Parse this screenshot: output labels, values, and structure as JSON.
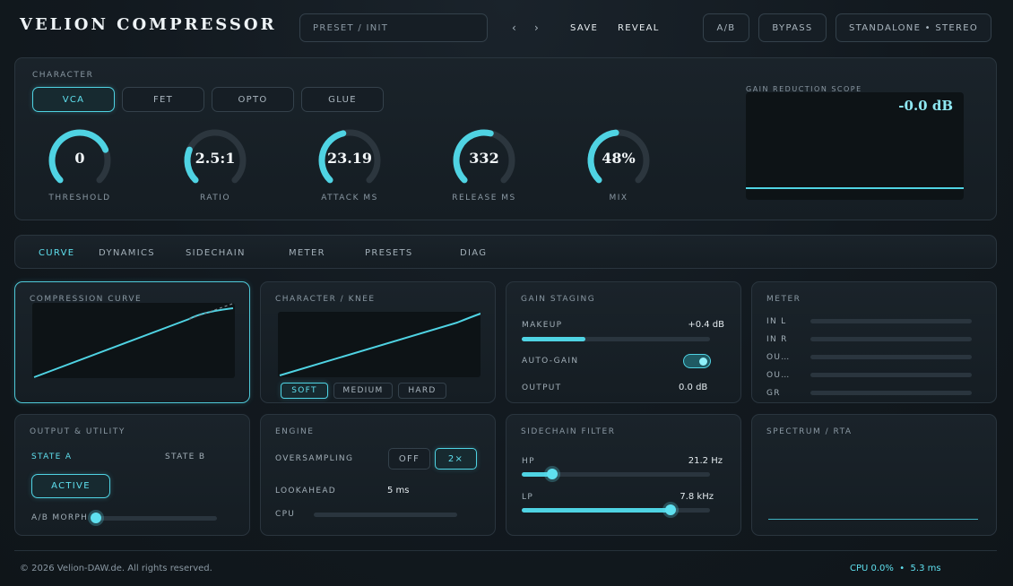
{
  "header": {
    "title": "VELION COMPRESSOR",
    "preset": "PRESET / INIT",
    "prev": "‹",
    "next": "›",
    "save": "SAVE",
    "reveal": "REVEAL",
    "ab": "A/B",
    "bypass": "BYPASS",
    "mode": "STANDALONE • STEREO"
  },
  "character": {
    "label": "CHARACTER",
    "modes": [
      "VCA",
      "FET",
      "OPTO",
      "GLUE"
    ],
    "active_mode": "VCA",
    "knobs": [
      {
        "label": "THRESHOLD",
        "value": "0",
        "level": 0.75
      },
      {
        "label": "RATIO",
        "value": "2.5:1",
        "level": 0.25
      },
      {
        "label": "ATTACK MS",
        "value": "23.19",
        "level": 0.45
      },
      {
        "label": "RELEASE MS",
        "value": "332",
        "level": 0.55
      },
      {
        "label": "MIX",
        "value": "48%",
        "level": 0.48
      }
    ]
  },
  "scope": {
    "label": "GAIN REDUCTION SCOPE",
    "value": "-0.0 dB"
  },
  "tabs": [
    "CURVE",
    "DYNAMICS",
    "SIDECHAIN",
    "METER",
    "PRESETS",
    "DIAG"
  ],
  "active_tab": "CURVE",
  "compression_curve": {
    "title": "COMPRESSION CURVE"
  },
  "knee": {
    "title": "CHARACTER / KNEE",
    "options": [
      "SOFT",
      "MEDIUM",
      "HARD"
    ],
    "active": "SOFT"
  },
  "gain_staging": {
    "title": "GAIN STAGING",
    "makeup_label": "MAKEUP",
    "makeup_value": "+0.4 dB",
    "makeup_level": 0.34,
    "autogain_label": "AUTO-GAIN",
    "autogain_on": true,
    "output_label": "OUTPUT",
    "output_value": "0.0 dB"
  },
  "meter": {
    "title": "METER",
    "channels": [
      "IN L",
      "IN R",
      "OU…",
      "OU…",
      "GR"
    ]
  },
  "output_utility": {
    "title": "OUTPUT & UTILITY",
    "state_a": "STATE A",
    "state_b": "STATE B",
    "active_btn": "ACTIVE",
    "morph_label": "A/B MORPH",
    "morph_level": 0.0
  },
  "engine": {
    "title": "ENGINE",
    "oversampling_label": "OVERSAMPLING",
    "os_options": [
      "OFF",
      "2×"
    ],
    "os_active": "2×",
    "lookahead_label": "LOOKAHEAD",
    "lookahead_value": "5 ms",
    "cpu_label": "CPU",
    "cpu_level": 0.0
  },
  "sidechain_filter": {
    "title": "SIDECHAIN FILTER",
    "hp_label": "HP",
    "hp_value": "21.2 Hz",
    "hp_level": 0.16,
    "lp_label": "LP",
    "lp_value": "7.8 kHz",
    "lp_level": 0.79
  },
  "spectrum": {
    "title": "SPECTRUM / RTA"
  },
  "footer": {
    "copyright": "© 2026 Velion-DAW.de. All rights reserved.",
    "status": "CPU 0.0%  •  5.3 ms"
  },
  "colors": {
    "accent": "#4fd3e3",
    "background": "#12191f",
    "panel": "#1a232a"
  }
}
